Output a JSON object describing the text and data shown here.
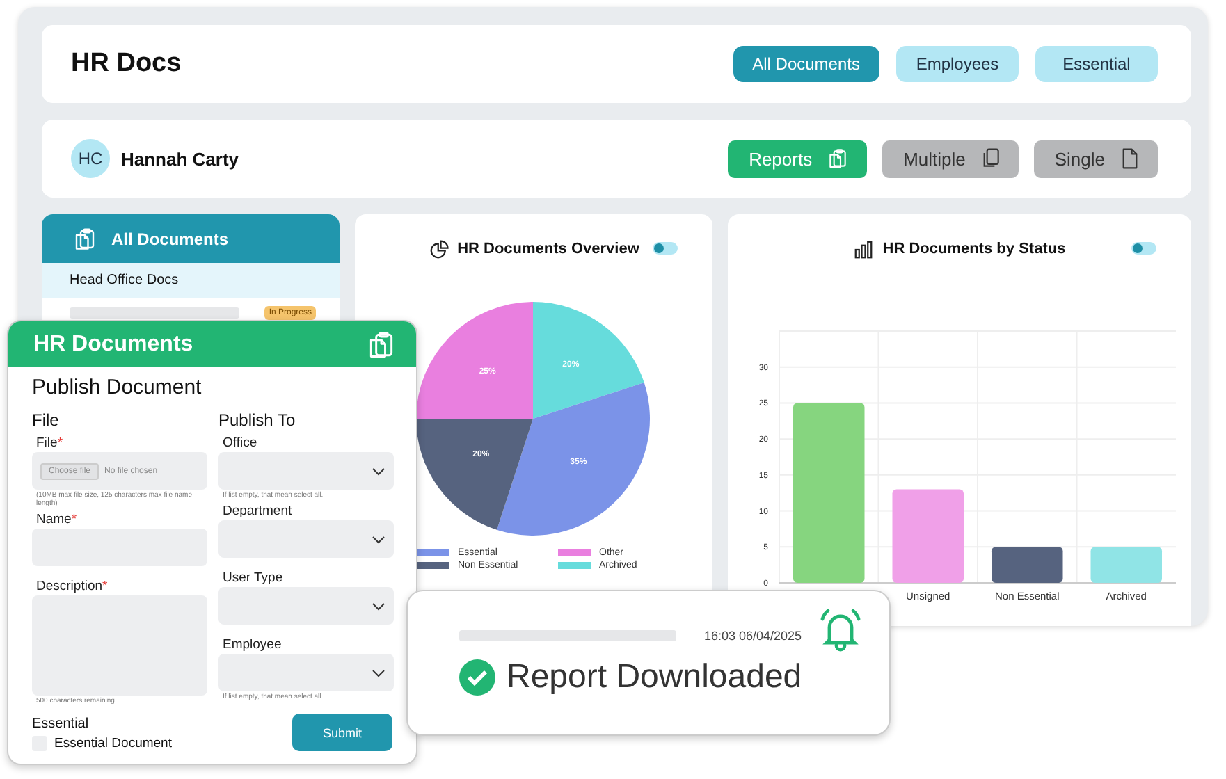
{
  "header": {
    "title": "HR Docs",
    "tabs": [
      {
        "label": "All Documents",
        "selected": true
      },
      {
        "label": "Employees",
        "selected": false
      },
      {
        "label": "Essential",
        "selected": false
      }
    ]
  },
  "user": {
    "initials": "HC",
    "name": "Hannah Carty"
  },
  "actions": [
    {
      "label": "Reports",
      "kind": "reports",
      "selected": true
    },
    {
      "label": "Multiple",
      "kind": "multiple",
      "selected": false
    },
    {
      "label": "Single",
      "kind": "single",
      "selected": false
    }
  ],
  "documents_panel": {
    "title": "All Documents",
    "items": [
      {
        "label": "Head Office Docs",
        "kind": "folder"
      },
      {
        "kind": "document",
        "status": "In Progress"
      }
    ]
  },
  "overview": {
    "title": "HR Documents Overview",
    "toggle": {
      "on": false
    },
    "chart_data": {
      "type": "pie",
      "categories": [
        "Archived",
        "Essential",
        "Non Essential",
        "Other"
      ],
      "series": [
        {
          "values": [
            20,
            35,
            20,
            25
          ]
        }
      ],
      "colors": [
        "#66dcdc",
        "#7b93e8",
        "#56637f",
        "#e97fdf"
      ],
      "value_labels": [
        "20%",
        "35%",
        "20%",
        "25%"
      ],
      "legend": "bottom"
    }
  },
  "status": {
    "title": "HR Documents by Status",
    "toggle": {
      "on": false
    },
    "chart_data": {
      "type": "bar",
      "categories": [
        null,
        "Unsigned",
        "Non Essential",
        "Archived"
      ],
      "series": [
        {
          "values": [
            25,
            13,
            5,
            5
          ]
        }
      ],
      "colors": [
        "#86d57f",
        "#f0a0e8",
        "#56637f",
        "#90e4e6"
      ],
      "grid": true,
      "ylim": [
        0,
        35
      ],
      "yticks": [
        0,
        5,
        10,
        15,
        20,
        25,
        30
      ]
    }
  },
  "form": {
    "title": "HR Documents",
    "heading": "Publish Document",
    "left": {
      "title": "File",
      "fields": [
        {
          "label": "File",
          "kind": "file",
          "marker": "*",
          "button": "Choose file",
          "value": "No file chosen",
          "hint": "(10MB max file size, 125 characters max file name length)"
        },
        {
          "label": "Name",
          "kind": "text",
          "marker": "*"
        },
        {
          "label": "Description",
          "kind": "textarea",
          "marker": "*",
          "hint": "500 characters remaining."
        }
      ]
    },
    "right": {
      "title": "Publish To",
      "fields": [
        {
          "label": "Office",
          "kind": "select",
          "hint": "If list empty, that mean select all."
        },
        {
          "label": "Department",
          "kind": "select"
        },
        {
          "label": "User Type",
          "kind": "select"
        },
        {
          "label": "Employee",
          "kind": "select",
          "hint": "If list empty, that mean select all."
        }
      ]
    },
    "essential": {
      "title": "Essential",
      "label": "Essential Document",
      "checked": false
    },
    "submit": "Submit"
  },
  "toast": {
    "time": "16:03 06/04/2025",
    "message": "Report Downloaded"
  }
}
